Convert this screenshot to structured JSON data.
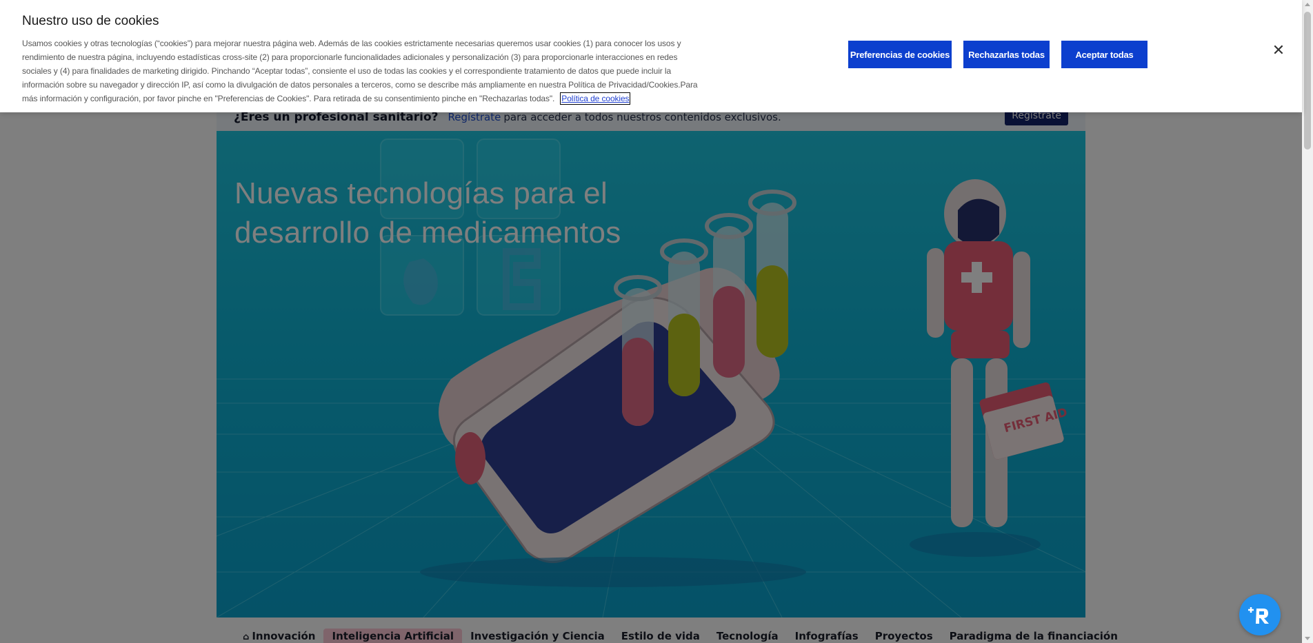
{
  "cookie_banner": {
    "title": "Nuestro uso de cookies",
    "text": "Usamos cookies y otras tecnologías (“cookies”) para mejorar nuestra página web. Además de las cookies estrictamente necesarias queremos usar cookies (1) para conocer los usos y rendimiento de nuestra página, incluyendo estadísticas cross-site (2) para proporcionarle funcionalidades adicionales y personalización (3) para proporcionarle interacciones en redes sociales y (4) para finalidades de marketing dirigido. Pinchando “Aceptar todas”, consiente el uso de todas las cookies y el correspondiente tratamiento de datos que puede incluir la información sobre su navegador y dirección IP, así como la divulgación de datos personales a terceros, como se describe más ampliamente en nuestra Política de Privacidad/Cookies.Para más información y configuración, por favor pinche en \"Preferencias de Cookies\". Para retirada de su consentimiento pinche en \"Rechazarlas todas\".",
    "policy_link": "Política de cookies",
    "btn_preferences": "Preferencias de cookies",
    "btn_reject": "Rechazarlas todas",
    "btn_accept": "Aceptar todas",
    "close_icon": "✕",
    "accent_color": "#0c3fce"
  },
  "pro_bar": {
    "question": "¿Eres un profesional sanitario?",
    "link": "Regístrate",
    "rest": "para acceder a todos nuestros contenidos exclusivos.",
    "button": "Regístrate"
  },
  "hero": {
    "title": "Nuevas tecnologías para el desarrollo de medicamentos",
    "robot_kit_label": "FIRST AID"
  },
  "nav": {
    "home_icon": "⌂",
    "tabs": [
      "Innovación",
      "Inteligencia Artificial",
      "Investigación y Ciencia",
      "Estilo de vida",
      "Tecnología",
      "Infografías",
      "Proyectos",
      "Paradigma de la financiación"
    ]
  },
  "fab": {
    "icon": "assistant-icon"
  }
}
